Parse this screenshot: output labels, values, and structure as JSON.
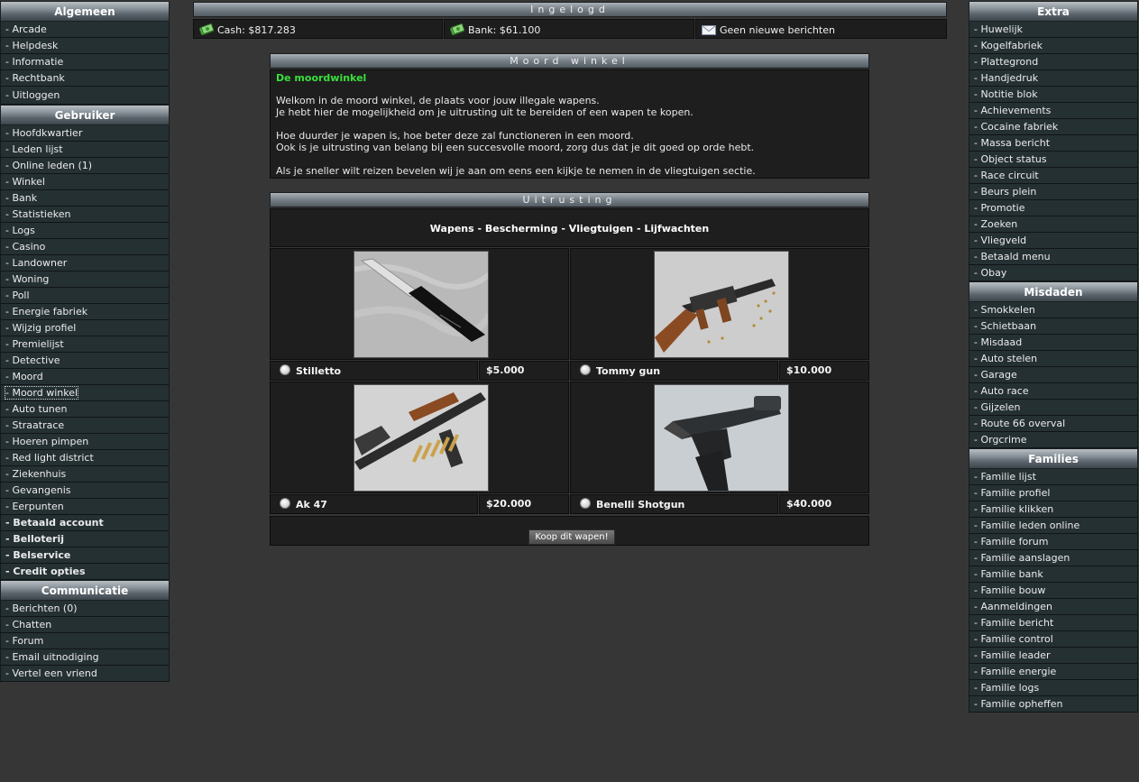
{
  "left_menu": [
    {
      "header": "Algemeen",
      "items": [
        {
          "label": "- Arcade"
        },
        {
          "label": "- Helpdesk"
        },
        {
          "label": "- Informatie"
        },
        {
          "label": "- Rechtbank"
        },
        {
          "label": "- Uitloggen"
        }
      ]
    },
    {
      "header": "Gebruiker",
      "items": [
        {
          "label": "- Hoofdkwartier"
        },
        {
          "label": "- Leden lijst"
        },
        {
          "label": "- Online leden (1)"
        },
        {
          "label": "- Winkel"
        },
        {
          "label": "- Bank"
        },
        {
          "label": "- Statistieken"
        },
        {
          "label": "- Logs"
        },
        {
          "label": "- Casino"
        },
        {
          "label": "- Landowner"
        },
        {
          "label": "- Woning"
        },
        {
          "label": "- Poll"
        },
        {
          "label": "- Energie fabriek"
        },
        {
          "label": "- Wijzig profiel"
        },
        {
          "label": "- Premielijst"
        },
        {
          "label": "- Detective"
        },
        {
          "label": "- Moord"
        },
        {
          "label": "- Moord winkel"
        },
        {
          "label": "- Auto tunen"
        },
        {
          "label": "- Straatrace"
        },
        {
          "label": "- Hoeren pimpen"
        },
        {
          "label": "- Red light district"
        },
        {
          "label": "- Ziekenhuis"
        },
        {
          "label": "- Gevangenis"
        },
        {
          "label": "- Eerpunten"
        },
        {
          "label": "- Betaald account"
        },
        {
          "label": "- Belloterij"
        },
        {
          "label": "- Belservice"
        },
        {
          "label": "- Credit opties"
        }
      ]
    },
    {
      "header": "Communicatie",
      "items": [
        {
          "label": "- Berichten (0)"
        },
        {
          "label": "- Chatten"
        },
        {
          "label": "- Forum"
        },
        {
          "label": "- Email uitnodiging"
        },
        {
          "label": "- Vertel een vriend"
        }
      ]
    }
  ],
  "right_menu": [
    {
      "header": "Extra",
      "items": [
        {
          "label": "- Huwelijk"
        },
        {
          "label": "- Kogelfabriek"
        },
        {
          "label": "- Plattegrond"
        },
        {
          "label": "- Handjedruk"
        },
        {
          "label": "- Notitie blok"
        },
        {
          "label": "- Achievements"
        },
        {
          "label": "- Cocaine fabriek"
        },
        {
          "label": "- Massa bericht"
        },
        {
          "label": "- Object status"
        },
        {
          "label": "- Race circuit"
        },
        {
          "label": "- Beurs plein"
        },
        {
          "label": "- Promotie"
        },
        {
          "label": "- Zoeken"
        },
        {
          "label": "- Vliegveld"
        },
        {
          "label": "- Betaald menu"
        },
        {
          "label": "- Obay"
        }
      ]
    },
    {
      "header": "Misdaden",
      "items": [
        {
          "label": "- Smokkelen"
        },
        {
          "label": "- Schietbaan"
        },
        {
          "label": "- Misdaad"
        },
        {
          "label": "- Auto stelen"
        },
        {
          "label": "- Garage"
        },
        {
          "label": "- Auto race"
        },
        {
          "label": "- Gijzelen"
        },
        {
          "label": "- Route 66 overval"
        },
        {
          "label": "- Orgcrime"
        }
      ]
    },
    {
      "header": "Families",
      "items": [
        {
          "label": "- Familie lijst"
        },
        {
          "label": "- Familie profiel"
        },
        {
          "label": "- Familie klikken"
        },
        {
          "label": "- Familie leden online"
        },
        {
          "label": "- Familie forum"
        },
        {
          "label": "- Familie aanslagen"
        },
        {
          "label": "- Familie bank"
        },
        {
          "label": "- Familie bouw"
        },
        {
          "label": "- Aanmeldingen"
        },
        {
          "label": "- Familie bericht"
        },
        {
          "label": "- Familie control"
        },
        {
          "label": "- Familie leader"
        },
        {
          "label": "- Familie energie"
        },
        {
          "label": "- Familie logs"
        },
        {
          "label": "- Familie opheffen"
        }
      ]
    }
  ],
  "status": {
    "title": "Ingelogd",
    "cash": "Cash: $817.283",
    "bank": "Bank: $61.100",
    "messages": "Geen nieuwe berichten",
    "cash_icon": "money-icon",
    "bank_icon": "money-icon",
    "messages_icon": "envelope-icon"
  },
  "shop": {
    "title": "Moord winkel",
    "headline": "De moordwinkel",
    "line1": "Welkom in de moord winkel, de plaats voor jouw illegale wapens.",
    "line2": "Je hebt hier de mogelijkheid om je uitrusting uit te bereiden of een wapen te kopen.",
    "line3": "Hoe duurder je wapen is, hoe beter deze zal functioneren in een moord.",
    "line4": "Ook is je uitrusting van belang bij een succesvolle moord, zorg dus dat je dit goed op orde hebt.",
    "line5": "Als je sneller wilt reizen bevelen wij je aan om eens een kijkje te nemen in de vliegtuigen sectie."
  },
  "equipment": {
    "title": "Uitrusting",
    "categories": [
      "Wapens",
      "Bescherming",
      "Vliegtuigen",
      "Lijfwachten"
    ],
    "separator": " - ",
    "weapons": [
      {
        "name": "Stilletto",
        "price": "$5.000"
      },
      {
        "name": "Tommy gun",
        "price": "$10.000"
      },
      {
        "name": "Ak 47",
        "price": "$20.000"
      },
      {
        "name": "Benelli Shotgun",
        "price": "$40.000"
      }
    ],
    "buy_label": "Koop dit wapen!"
  },
  "colors": {
    "background": "#363636",
    "menu_item": "#253033",
    "panel": "#1e1e1e",
    "headline_green": "#39e03a"
  }
}
